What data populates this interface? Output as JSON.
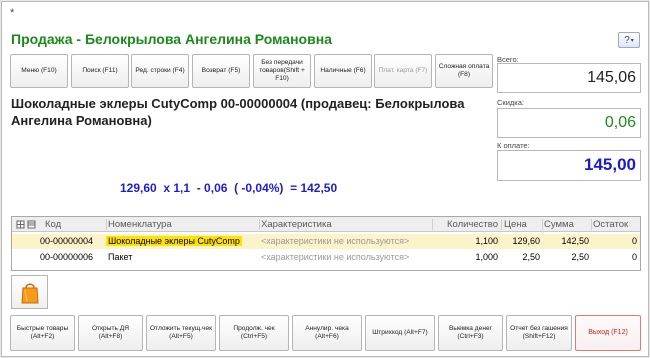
{
  "asterisk": "*",
  "title": "Продажа - Белокрылова Ангелина Романовна",
  "help_button": "?",
  "toolbar": [
    {
      "label": "Меню (F10)",
      "disabled": false
    },
    {
      "label": "Поиск (F11)",
      "disabled": false
    },
    {
      "label": "Ред. строки (F4)",
      "disabled": false
    },
    {
      "label": "Возврат (F5)",
      "disabled": false
    },
    {
      "label": "Без передачи товаров(Shift + F10)",
      "disabled": false
    },
    {
      "label": "Наличные (F6)",
      "disabled": false
    },
    {
      "label": "Плат. карта (F7)",
      "disabled": true
    },
    {
      "label": "Сложная оплата (F8)",
      "disabled": false
    }
  ],
  "item_title": "Шоколадные эклеры CutyComp 00-00000004 (продавец: Белокрылова Ангелина Романовна)",
  "calc_line": "129,60  x 1,1  - 0,06  ( -0,04%)  = 142,50",
  "totals": {
    "total_label": "Всего:",
    "total_value": "145,06",
    "discount_label": "Скидка:",
    "discount_value": "0,06",
    "pay_label": "К оплате:",
    "pay_value": "145,00"
  },
  "grid": {
    "columns": [
      "Код",
      "Номенклатура",
      "Характеристика",
      "Количество",
      "Цена",
      "Сумма",
      "Остаток"
    ],
    "rows": [
      {
        "code": "00-00000004",
        "name": "Шоколадные эклеры CutyComp",
        "char": "<характеристики не используются>",
        "qty": "1,100",
        "price": "129,60",
        "sum": "142,50",
        "rest": "0"
      },
      {
        "code": "00-00000006",
        "name": "Пакет",
        "char": "<характеристики не используются>",
        "qty": "1,000",
        "price": "2,50",
        "sum": "2,50",
        "rest": "0"
      }
    ]
  },
  "bottom_buttons": [
    "Быстрые товары (Alt+F2)",
    "Открыть ДЯ (Alt+F8)",
    "Отложить текущ.чек (Alt+F5)",
    "Продолж. чек (Ctrl+F5)",
    "Аннулир. чека (Alt+F6)",
    "Штрихкод (Alt+F7)",
    "Выемка денег (Ctrl+F3)",
    "Отчет без гашения (Shift+F12)",
    "Выход (F12)"
  ],
  "colors": {
    "title_green": "#1b8a1b",
    "discount_green": "#1a8f1a",
    "pay_blue": "#1a1ad0",
    "calc_blue": "#1d1dd4",
    "selected_row": "#fbf3c9",
    "highlight_yellow": "#ffe300",
    "exit_red": "#d02020"
  },
  "icons": {
    "bag": "shopping-bag-icon",
    "grid_tools": "grid-settings-icon"
  }
}
